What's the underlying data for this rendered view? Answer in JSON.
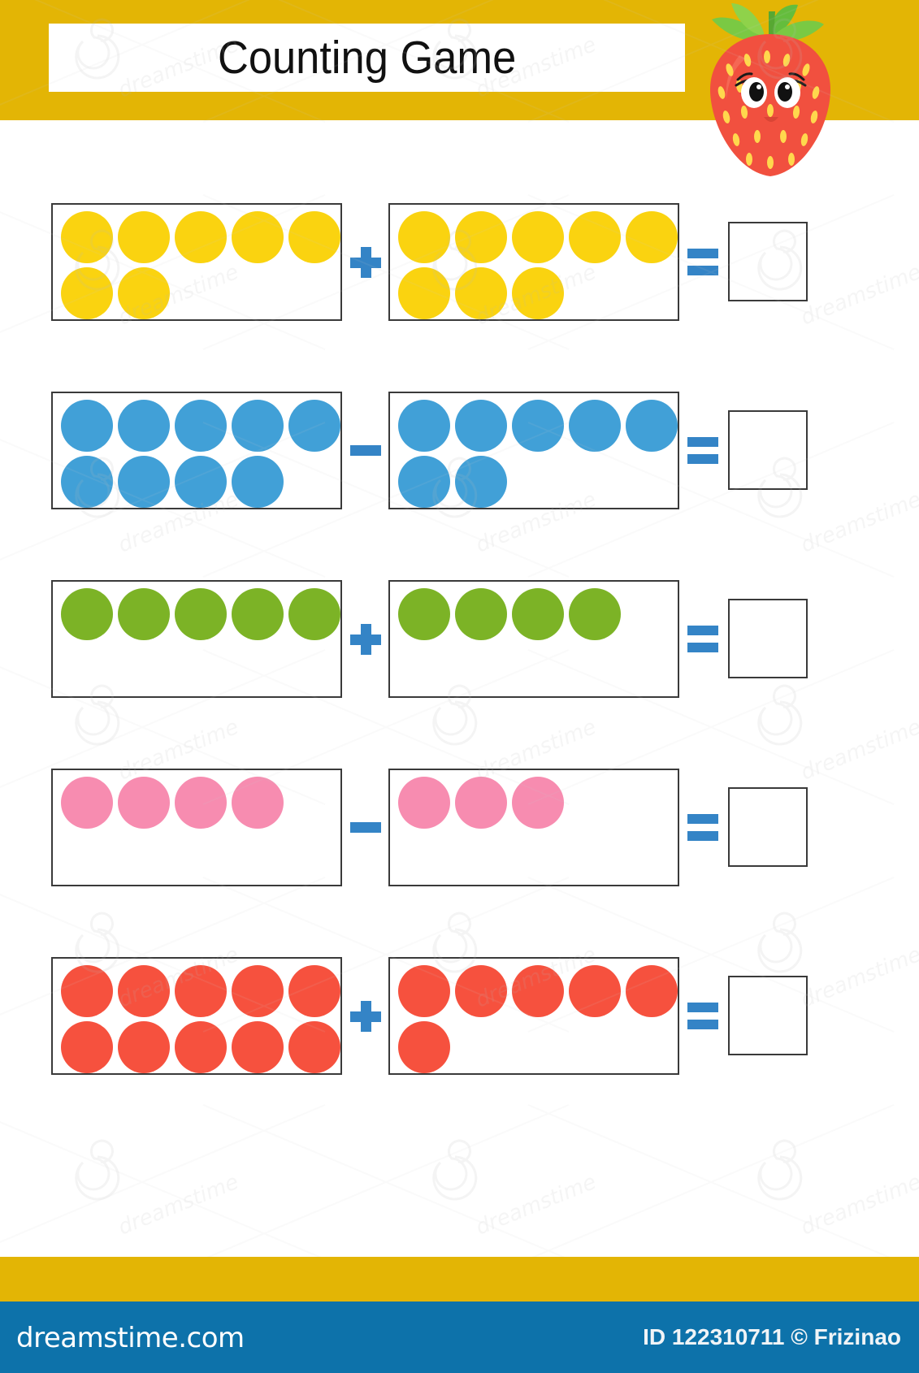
{
  "header": {
    "title": "Counting Game",
    "band_color": "#e3b505",
    "title_box_color": "#ffffff",
    "mascot": "strawberry-character"
  },
  "colors": {
    "yellow": "#fad310",
    "blue": "#41a0d7",
    "green": "#7cb326",
    "pink": "#f78cb0",
    "red": "#f6513e",
    "operator_blue": "#3484c6",
    "box_border": "#3a3a3a",
    "band_yellow": "#e3b505",
    "footer_blue": "#0d72aa"
  },
  "problems": [
    {
      "id": "problem-1",
      "color_name": "yellow",
      "color": "#fad310",
      "operator": "+",
      "operator_name": "plus",
      "equals": "=",
      "left": {
        "rows": [
          5,
          2
        ],
        "total": 7
      },
      "right": {
        "rows": [
          5,
          3
        ],
        "total": 8
      },
      "answer": ""
    },
    {
      "id": "problem-2",
      "color_name": "blue",
      "color": "#41a0d7",
      "operator": "−",
      "operator_name": "minus",
      "equals": "=",
      "left": {
        "rows": [
          5,
          4
        ],
        "total": 9
      },
      "right": {
        "rows": [
          5,
          2
        ],
        "total": 7
      },
      "answer": ""
    },
    {
      "id": "problem-3",
      "color_name": "green",
      "color": "#7cb326",
      "operator": "+",
      "operator_name": "plus",
      "equals": "=",
      "left": {
        "rows": [
          5
        ],
        "total": 5
      },
      "right": {
        "rows": [
          4
        ],
        "total": 4
      },
      "answer": ""
    },
    {
      "id": "problem-4",
      "color_name": "pink",
      "color": "#f78cb0",
      "operator": "−",
      "operator_name": "minus",
      "equals": "=",
      "left": {
        "rows": [
          4
        ],
        "total": 4
      },
      "right": {
        "rows": [
          3
        ],
        "total": 3
      },
      "answer": ""
    },
    {
      "id": "problem-5",
      "color_name": "red",
      "color": "#f6513e",
      "operator": "+",
      "operator_name": "plus",
      "equals": "=",
      "left": {
        "rows": [
          5,
          5
        ],
        "total": 10
      },
      "right": {
        "rows": [
          5,
          1
        ],
        "total": 6
      },
      "answer": ""
    }
  ],
  "footer": {
    "logo_text": "dreamstime.com",
    "credit": "ID 122310711 © Frizinao"
  },
  "watermark": {
    "text": "dreamstime"
  }
}
